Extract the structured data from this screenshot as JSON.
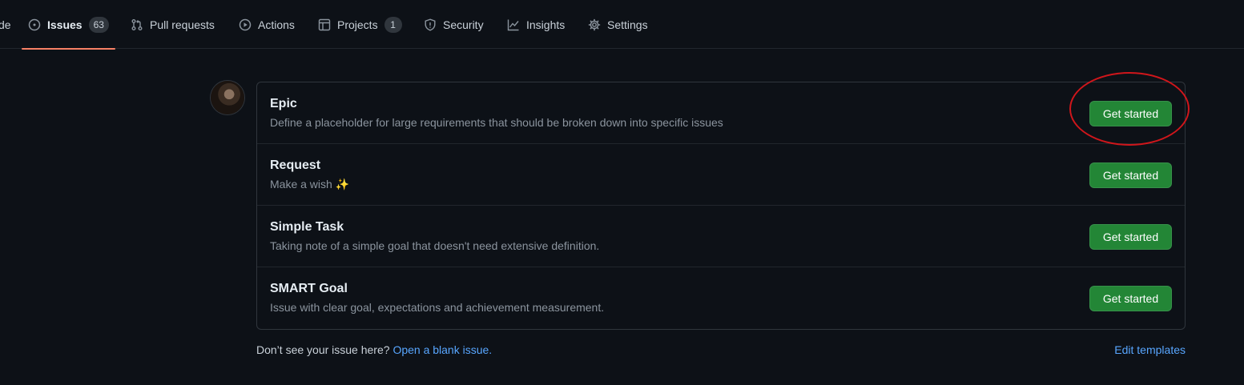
{
  "nav": {
    "cut_label": "de",
    "issues": {
      "label": "Issues",
      "count": "63"
    },
    "pull_requests": {
      "label": "Pull requests"
    },
    "actions": {
      "label": "Actions"
    },
    "projects": {
      "label": "Projects",
      "count": "1"
    },
    "security": {
      "label": "Security"
    },
    "insights": {
      "label": "Insights"
    },
    "settings": {
      "label": "Settings"
    }
  },
  "templates": [
    {
      "title": "Epic",
      "description": "Define a placeholder for large requirements that should be broken down into specific issues",
      "button": "Get started"
    },
    {
      "title": "Request",
      "description": "Make a wish ✨",
      "button": "Get started"
    },
    {
      "title": "Simple Task",
      "description": "Taking note of a simple goal that doesn't need extensive definition.",
      "button": "Get started"
    },
    {
      "title": "SMART Goal",
      "description": "Issue with clear goal, expectations and achievement measurement.",
      "button": "Get started"
    }
  ],
  "footer": {
    "prompt": "Don’t see your issue here?",
    "blank_link": "Open a blank issue.",
    "edit_link": "Edit templates"
  },
  "colors": {
    "background": "#0d1117",
    "accent_underline": "#f78166",
    "button_green": "#238636",
    "link_blue": "#58a6ff",
    "annotation_red": "#d0161b"
  }
}
